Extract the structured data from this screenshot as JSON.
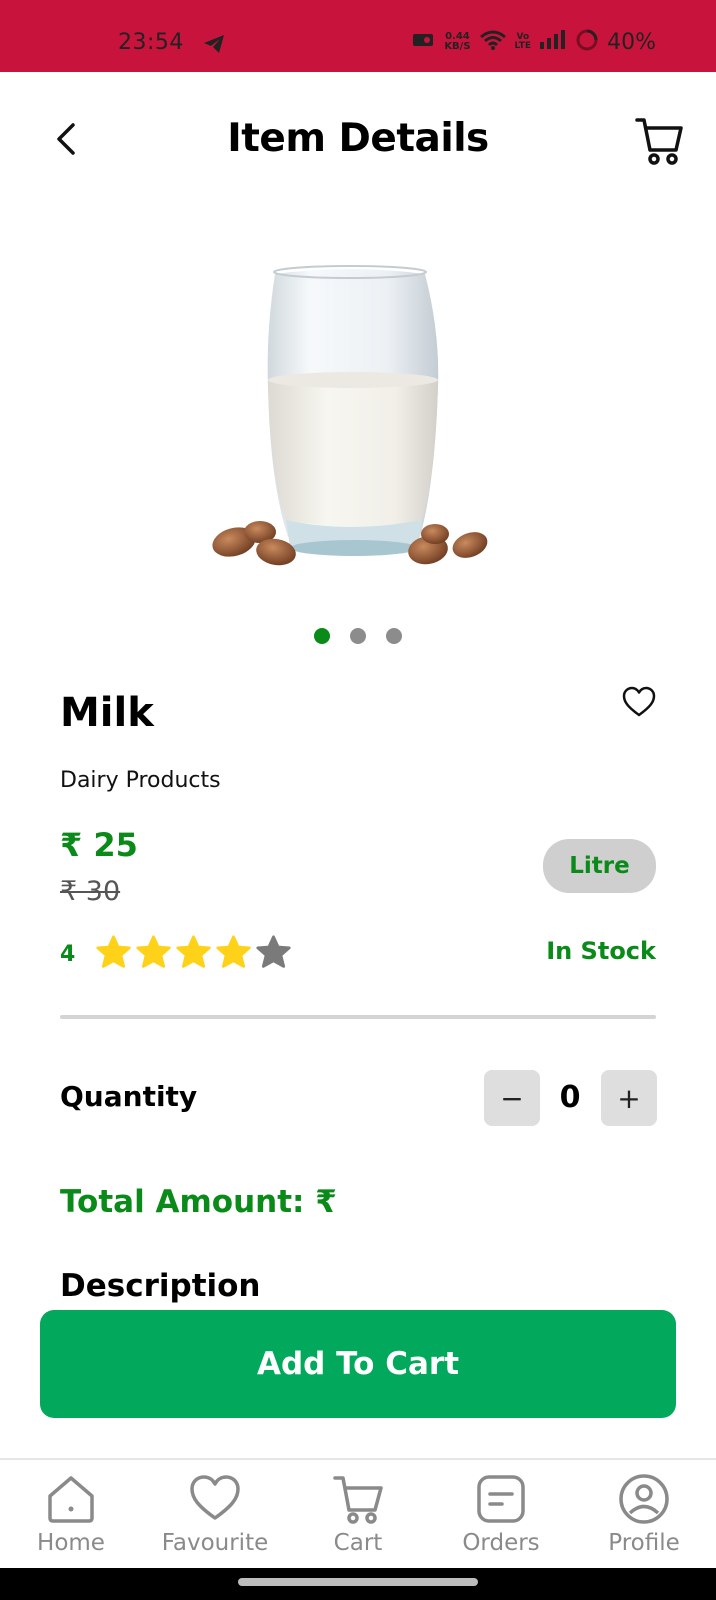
{
  "status_bar": {
    "time": "23:54",
    "speed_value": "0.44",
    "speed_unit": "KB/S",
    "volte_top": "Vo",
    "volte_bottom": "LTE",
    "battery": "40%"
  },
  "header": {
    "title": "Item Details"
  },
  "product": {
    "name": "Milk",
    "category": "Dairy Products",
    "price": "₹ 25",
    "mrp": "₹ 30",
    "unit": "Litre",
    "rating": "4",
    "rating_value": 4,
    "rating_max": 5,
    "stock_status": "In Stock",
    "image_count": 3,
    "active_image": 1
  },
  "quantity": {
    "label": "Quantity",
    "value": "0",
    "minus": "−",
    "plus": "+"
  },
  "total": {
    "label": "Total Amount: ₹"
  },
  "description": {
    "heading": "Description"
  },
  "add_to_cart": {
    "label": "Add To Cart"
  },
  "bottom_nav": {
    "items": [
      {
        "label": "Home",
        "icon": "home-icon"
      },
      {
        "label": "Favourite",
        "icon": "heart-icon"
      },
      {
        "label": "Cart",
        "icon": "cart-icon"
      },
      {
        "label": "Orders",
        "icon": "orders-icon"
      },
      {
        "label": "Profile",
        "icon": "profile-icon"
      }
    ]
  },
  "colors": {
    "status_bar": "#c8143c",
    "accent_green": "#0a8a18",
    "button_green": "#02a95c",
    "star_yellow": "#ffd21a",
    "star_gray": "#7a7a7a"
  }
}
